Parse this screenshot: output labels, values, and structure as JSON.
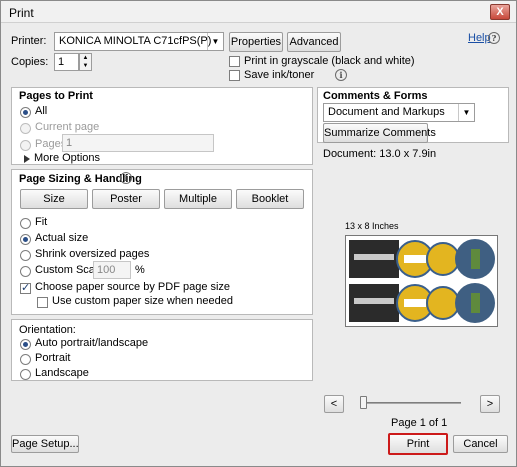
{
  "window": {
    "title": "Print",
    "close": "X"
  },
  "printer": {
    "label": "Printer:",
    "selected": "KONICA MINOLTA C71cfPS(P)",
    "properties": "Properties",
    "advanced": "Advanced",
    "help": "Help",
    "help_icon": "?"
  },
  "copies": {
    "label": "Copies:",
    "value": "1"
  },
  "options": {
    "grayscale": "Print in grayscale (black and white)",
    "grayscale_checked": false,
    "save_ink": "Save ink/toner",
    "save_ink_checked": false,
    "info_icon": "i"
  },
  "pages_to_print": {
    "title": "Pages to Print",
    "all": "All",
    "current_page": "Current page",
    "pages": "Pages",
    "pages_value": "1",
    "more_options": "More Options",
    "selected": "All"
  },
  "sizing": {
    "title": "Page Sizing & Handling",
    "info_icon": "i",
    "buttons": [
      "Size",
      "Poster",
      "Multiple",
      "Booklet"
    ],
    "fit": "Fit",
    "actual_size": "Actual size",
    "shrink": "Shrink oversized pages",
    "custom_scale": "Custom Scale:",
    "custom_scale_value": "100",
    "percent": "%",
    "selected": "Actual size",
    "choose_source": "Choose paper source by PDF page size",
    "choose_source_checked": true,
    "custom_paper": "Use custom paper size when needed",
    "custom_paper_checked": false
  },
  "orientation": {
    "title": "Orientation:",
    "auto": "Auto portrait/landscape",
    "portrait": "Portrait",
    "landscape": "Landscape",
    "selected": "Auto portrait/landscape"
  },
  "comments": {
    "title": "Comments & Forms",
    "selected": "Document and Markups",
    "summarize": "Summarize Comments"
  },
  "preview": {
    "document_size": "Document: 13.0 x 7.9in",
    "page_size": "13 x 8 Inches",
    "prev": "<",
    "next": ">",
    "page_indicator": "Page 1 of 1",
    "slider_position": 0
  },
  "footer": {
    "page_setup": "Page Setup...",
    "print": "Print",
    "cancel": "Cancel"
  },
  "colors": {
    "accent": "#2c4f88",
    "highlight": "#cc1a1a",
    "link": "#1a4fa5"
  }
}
